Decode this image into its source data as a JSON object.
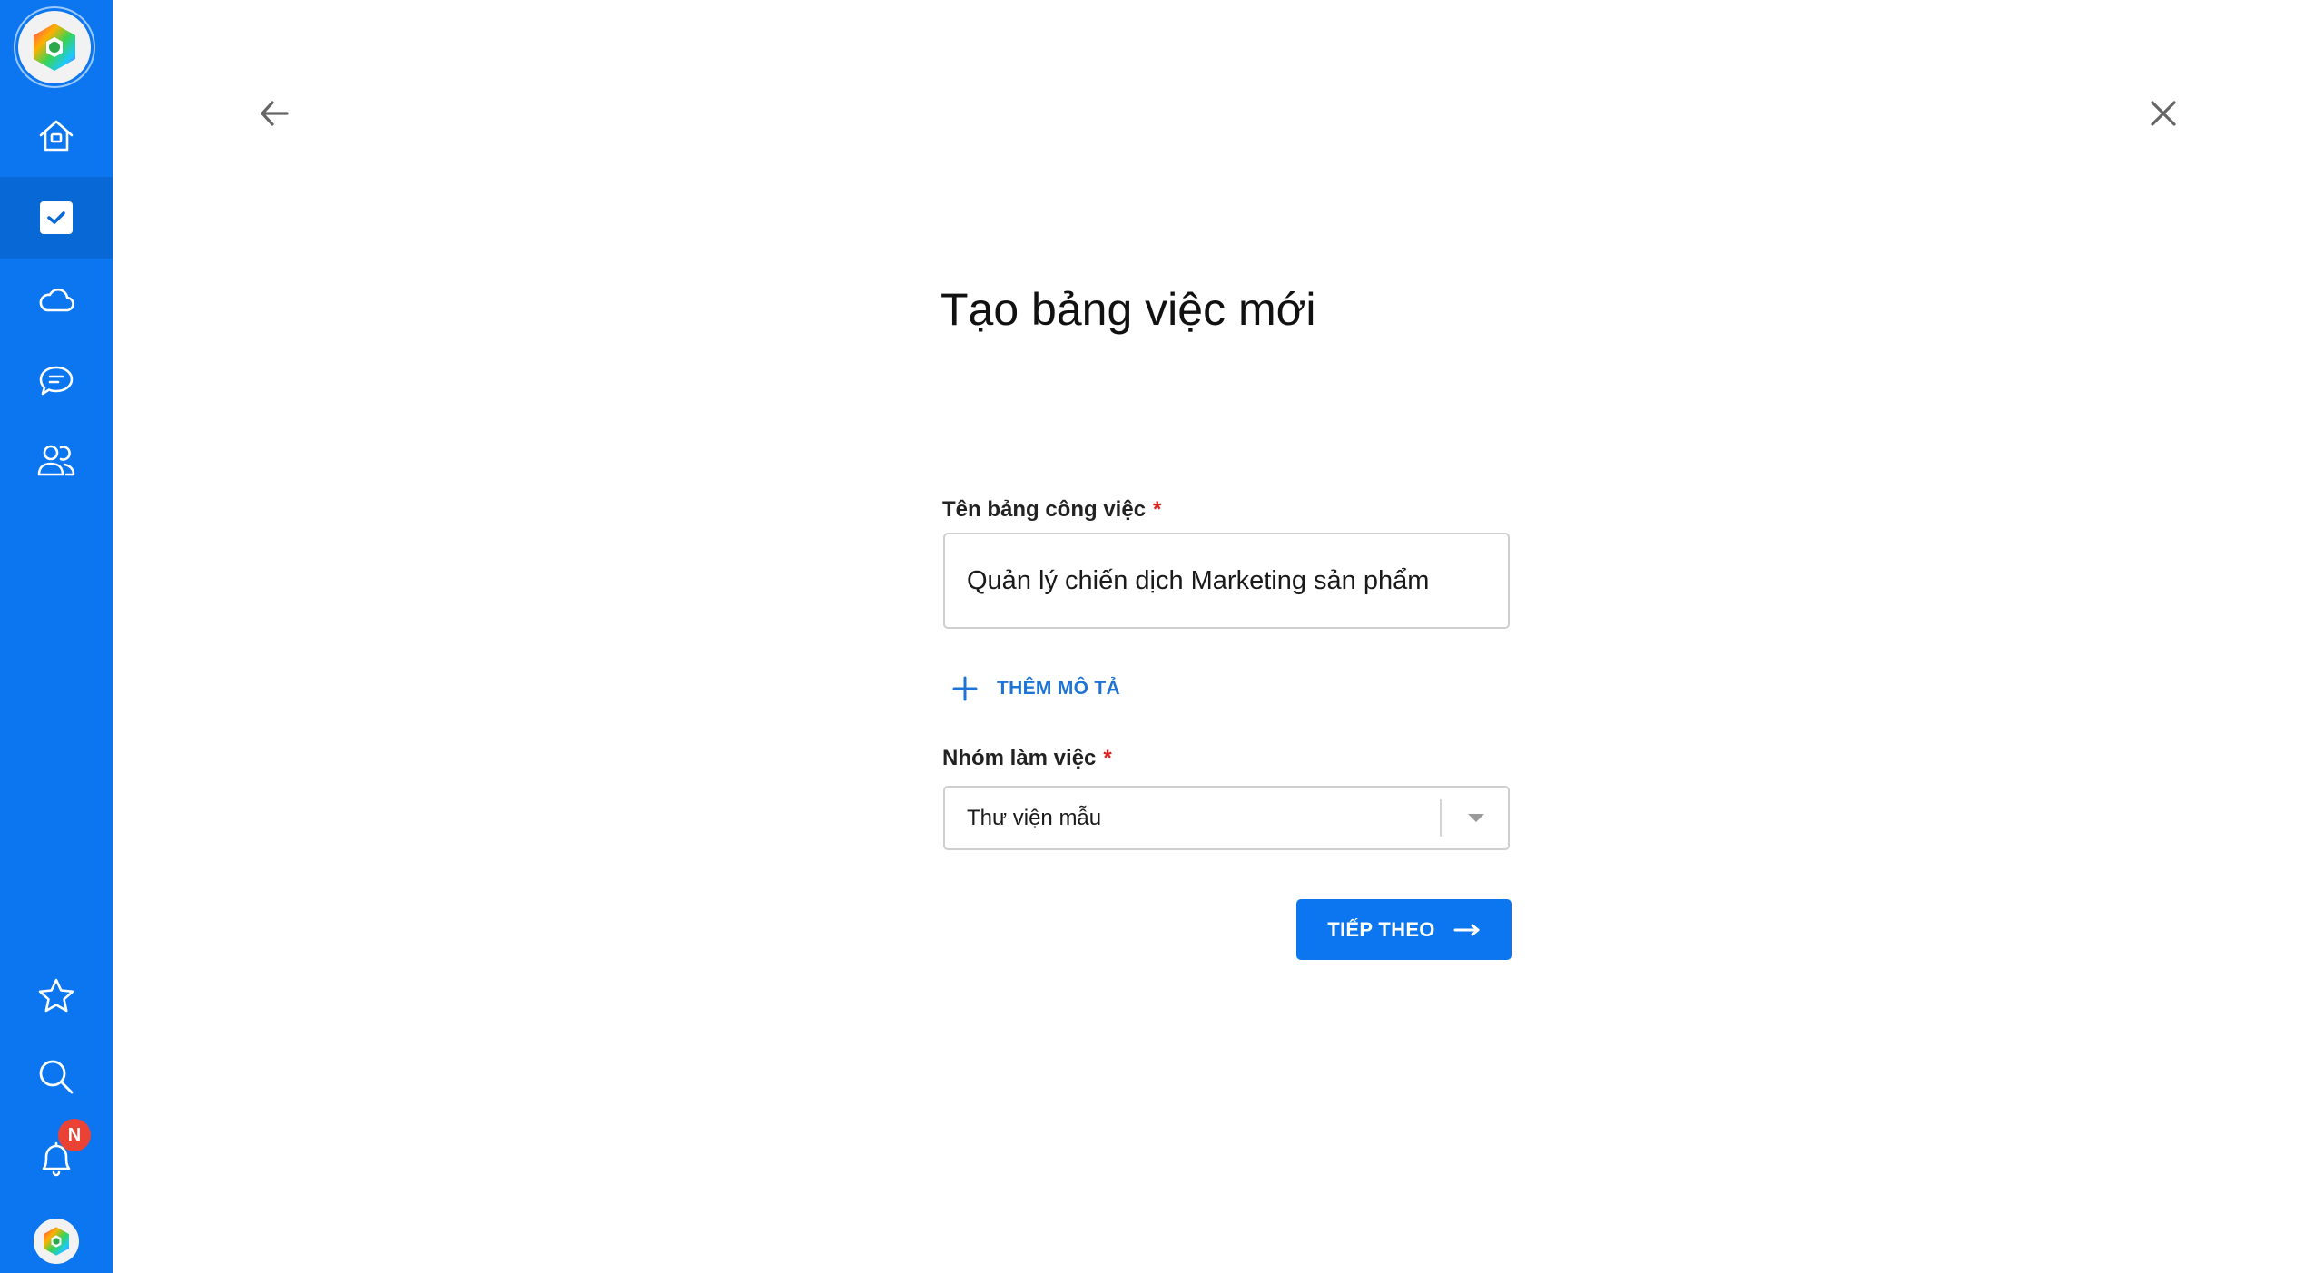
{
  "sidebar": {
    "logo": "app-logo",
    "items": [
      {
        "id": "home",
        "icon": "home-icon",
        "active": false
      },
      {
        "id": "tasks",
        "icon": "task-checkbox-icon",
        "active": true
      },
      {
        "id": "cloud",
        "icon": "cloud-icon",
        "active": false
      },
      {
        "id": "chat",
        "icon": "chat-icon",
        "active": false
      },
      {
        "id": "contacts",
        "icon": "users-icon",
        "active": false
      }
    ],
    "bottom_items": [
      {
        "id": "favorites",
        "icon": "star-icon"
      },
      {
        "id": "search",
        "icon": "search-icon"
      },
      {
        "id": "notifications",
        "icon": "bell-icon",
        "badge": "N"
      },
      {
        "id": "profile",
        "icon": "avatar"
      }
    ],
    "colors": {
      "background": "#0b76f0",
      "active": "#0868d6"
    }
  },
  "header": {
    "back_icon": "arrow-left-icon",
    "close_icon": "close-icon"
  },
  "form": {
    "title": "Tạo bảng việc mới",
    "board_name": {
      "label": "Tên bảng công việc",
      "required_mark": "*",
      "value": "Quản lý chiến dịch Marketing sản phẩm"
    },
    "add_description_label": "THÊM MÔ TẢ",
    "workgroup": {
      "label": "Nhóm làm việc",
      "required_mark": "*",
      "selected": "Thư viện mẫu"
    },
    "next_button_label": "TIẾP THEO"
  },
  "colors": {
    "accent": "#0b76f0",
    "link": "#1e74d6",
    "required": "#e02020"
  }
}
